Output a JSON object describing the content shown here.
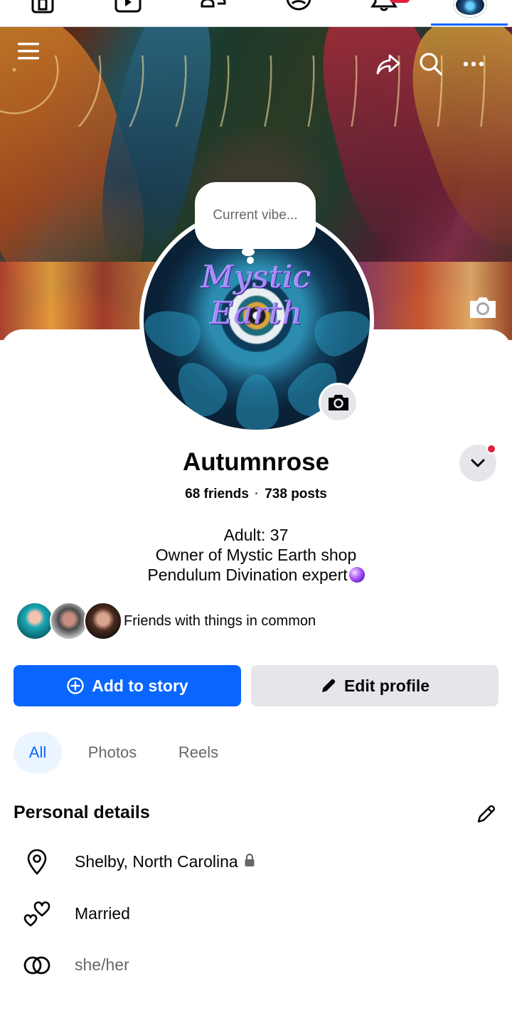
{
  "nav": {
    "icons": [
      "home-icon",
      "video-icon",
      "friends-icon",
      "groups-icon",
      "notifications-icon",
      "profile-avatar"
    ]
  },
  "cover": {
    "menu_icon": "hamburger-icon",
    "share_icon": "share-icon",
    "search_icon": "search-icon",
    "more_icon": "more-icon",
    "camera_icon": "camera-icon"
  },
  "profile": {
    "logo_text": "Mystic Earth",
    "vibe_placeholder": "Current vibe...",
    "name": "Autumnrose",
    "friends": "68 friends",
    "separator": "·",
    "posts": "738 posts",
    "bio": [
      "Adult: 37",
      "Owner of Mystic Earth shop",
      "Pendulum Divination expert"
    ],
    "mutual_text": "Friends with things in common"
  },
  "actions": {
    "add_story": "Add to story",
    "edit_profile": "Edit profile"
  },
  "tabs": [
    "All",
    "Photos",
    "Reels"
  ],
  "details": {
    "title": "Personal details",
    "location": "Shelby, North Carolina",
    "relationship": "Married",
    "pronouns": "she/her"
  },
  "colors": {
    "primary": "#0866ff",
    "secondary_bg": "#e4e6eb",
    "badge_red": "#e41e3f",
    "tab_active_bg": "#ebf5ff"
  }
}
